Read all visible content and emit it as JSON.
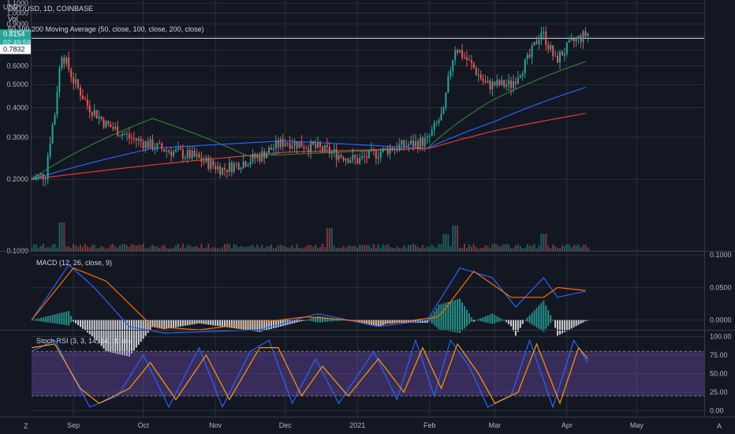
{
  "header": {
    "currency": "USD",
    "symbol_line": "OXT/USD, 1D, COINBASE",
    "vol_label": "Vol",
    "ma_label": "50,100,200 Moving Average (50, close, 100, close, 200, close)"
  },
  "price_tags": {
    "last_price": "0.8154",
    "countdown": "02:49:59",
    "level": "0.7832"
  },
  "corners": {
    "bottom_left": "Z",
    "bottom_right": "A"
  },
  "colors": {
    "background": "#131722",
    "grid": "#2a2e39",
    "up": "#26a69a",
    "down": "#ef5350",
    "ma50": "#2e7d32",
    "ma100": "#2962ff",
    "ma200": "#e53935",
    "macd_line": "#2962ff",
    "signal_line": "#ff6d00",
    "stoch_k": "#2962ff",
    "stoch_d": "#ff9800",
    "stoch_band": "#7e57c2",
    "price_tag": "#26a69a",
    "level_tag": "#ffffff"
  },
  "chart_data": {
    "type": "candlestick",
    "x_ticks": [
      "Sep",
      "Oct",
      "Nov",
      "Dec",
      "2021",
      "Feb",
      "Mar",
      "Apr",
      "May"
    ],
    "x_range": [
      "2020-08-14",
      "2021-05-30"
    ],
    "price_axis": {
      "ticks": [
        "1.1000",
        "1.0000",
        "0.9000",
        "0.8000",
        "0.7000",
        "0.6000",
        "0.5000",
        "0.4000",
        "0.3000",
        "0.2000",
        "0.1000"
      ],
      "range": [
        0.1,
        1.1
      ],
      "scale": "log"
    },
    "horizontal_line": 0.7832,
    "price_path": [
      [
        "2020-08-14",
        0.2
      ],
      [
        "2020-08-20",
        0.21
      ],
      [
        "2020-08-24",
        0.38
      ],
      [
        "2020-08-27",
        0.68
      ],
      [
        "2020-09-01",
        0.52
      ],
      [
        "2020-09-07",
        0.41
      ],
      [
        "2020-09-15",
        0.34
      ],
      [
        "2020-09-25",
        0.3
      ],
      [
        "2020-10-08",
        0.27
      ],
      [
        "2020-10-22",
        0.25
      ],
      [
        "2020-11-04",
        0.22
      ],
      [
        "2020-11-20",
        0.25
      ],
      [
        "2020-12-01",
        0.29
      ],
      [
        "2020-12-15",
        0.27
      ],
      [
        "2021-01-01",
        0.24
      ],
      [
        "2021-01-15",
        0.27
      ],
      [
        "2021-01-31",
        0.29
      ],
      [
        "2021-02-07",
        0.38
      ],
      [
        "2021-02-12",
        0.72
      ],
      [
        "2021-02-18",
        0.62
      ],
      [
        "2021-02-25",
        0.5
      ],
      [
        "2021-03-08",
        0.5
      ],
      [
        "2021-03-16",
        0.65
      ],
      [
        "2021-03-21",
        0.84
      ],
      [
        "2021-03-27",
        0.63
      ],
      [
        "2021-04-04",
        0.76
      ],
      [
        "2021-04-10",
        0.82
      ]
    ],
    "ma50_path": [
      [
        "2020-08-14",
        0.2
      ],
      [
        "2020-10-05",
        0.36
      ],
      [
        "2020-11-15",
        0.25
      ],
      [
        "2021-01-31",
        0.27
      ],
      [
        "2021-02-28",
        0.43
      ],
      [
        "2021-04-10",
        0.63
      ]
    ],
    "ma100_path": [
      [
        "2020-08-14",
        0.2
      ],
      [
        "2020-10-05",
        0.27
      ],
      [
        "2020-11-30",
        0.29
      ],
      [
        "2021-01-31",
        0.27
      ],
      [
        "2021-03-01",
        0.35
      ],
      [
        "2021-04-10",
        0.49
      ]
    ],
    "ma200_path": [
      [
        "2020-08-14",
        0.2
      ],
      [
        "2020-10-05",
        0.23
      ],
      [
        "2020-12-01",
        0.26
      ],
      [
        "2021-02-01",
        0.27
      ],
      [
        "2021-03-01",
        0.32
      ],
      [
        "2021-04-10",
        0.38
      ]
    ],
    "volume_spikes": [
      [
        "2020-08-27",
        1.0
      ],
      [
        "2020-12-20",
        0.8
      ],
      [
        "2021-02-08",
        0.6
      ],
      [
        "2021-02-12",
        0.9
      ],
      [
        "2021-03-22",
        0.6
      ]
    ],
    "macd": {
      "label": "MACD (12, 26, close, 9)",
      "ticks": [
        "0.1000",
        "0.0500",
        "0.0000"
      ],
      "range": [
        -0.015,
        0.105
      ],
      "macd_path": [
        [
          "2020-08-14",
          0.0
        ],
        [
          "2020-08-30",
          0.085
        ],
        [
          "2020-09-10",
          0.05
        ],
        [
          "2020-09-25",
          -0.01
        ],
        [
          "2020-10-10",
          -0.02
        ],
        [
          "2020-11-20",
          -0.015
        ],
        [
          "2020-12-15",
          0.01
        ],
        [
          "2021-01-10",
          -0.01
        ],
        [
          "2021-01-31",
          0.0
        ],
        [
          "2021-02-14",
          0.08
        ],
        [
          "2021-02-28",
          0.065
        ],
        [
          "2021-03-10",
          0.02
        ],
        [
          "2021-03-22",
          0.065
        ],
        [
          "2021-03-28",
          0.035
        ],
        [
          "2021-04-10",
          0.045
        ]
      ],
      "signal_path": [
        [
          "2020-08-14",
          0.0
        ],
        [
          "2020-09-01",
          0.08
        ],
        [
          "2020-09-15",
          0.06
        ],
        [
          "2020-10-05",
          -0.01
        ],
        [
          "2020-10-25",
          -0.015
        ],
        [
          "2020-12-10",
          0.005
        ],
        [
          "2021-01-15",
          -0.005
        ],
        [
          "2021-02-05",
          0.005
        ],
        [
          "2021-02-20",
          0.075
        ],
        [
          "2021-03-08",
          0.035
        ],
        [
          "2021-03-22",
          0.035
        ],
        [
          "2021-03-28",
          0.05
        ],
        [
          "2021-04-10",
          0.045
        ]
      ]
    },
    "stoch_rsi": {
      "label": "Stoch RSI (3, 3, 14, 14, close)",
      "ticks": [
        "100.00",
        "75.00",
        "50.00",
        "25.00",
        "0.00"
      ],
      "range": [
        -8,
        108
      ],
      "band": [
        20,
        80
      ],
      "k_path": [
        [
          "2020-08-14",
          80
        ],
        [
          "2020-08-24",
          95
        ],
        [
          "2020-09-01",
          45
        ],
        [
          "2020-09-08",
          5
        ],
        [
          "2020-09-20",
          20
        ],
        [
          "2020-10-01",
          75
        ],
        [
          "2020-10-12",
          5
        ],
        [
          "2020-10-25",
          85
        ],
        [
          "2020-11-04",
          5
        ],
        [
          "2020-11-16",
          80
        ],
        [
          "2020-11-24",
          95
        ],
        [
          "2020-12-04",
          10
        ],
        [
          "2020-12-14",
          70
        ],
        [
          "2020-12-24",
          10
        ],
        [
          "2021-01-08",
          80
        ],
        [
          "2021-01-18",
          15
        ],
        [
          "2021-01-26",
          95
        ],
        [
          "2021-02-03",
          20
        ],
        [
          "2021-02-10",
          95
        ],
        [
          "2021-02-18",
          60
        ],
        [
          "2021-02-26",
          5
        ],
        [
          "2021-03-08",
          20
        ],
        [
          "2021-03-16",
          95
        ],
        [
          "2021-03-26",
          5
        ],
        [
          "2021-04-04",
          95
        ],
        [
          "2021-04-10",
          65
        ]
      ],
      "d_path": [
        [
          "2020-08-14",
          85
        ],
        [
          "2020-08-24",
          90
        ],
        [
          "2020-09-04",
          30
        ],
        [
          "2020-09-12",
          10
        ],
        [
          "2020-09-25",
          30
        ],
        [
          "2020-10-04",
          65
        ],
        [
          "2020-10-15",
          15
        ],
        [
          "2020-10-28",
          75
        ],
        [
          "2020-11-07",
          15
        ],
        [
          "2020-11-20",
          85
        ],
        [
          "2020-11-28",
          85
        ],
        [
          "2020-12-08",
          20
        ],
        [
          "2020-12-17",
          60
        ],
        [
          "2020-12-28",
          20
        ],
        [
          "2021-01-10",
          70
        ],
        [
          "2021-01-21",
          25
        ],
        [
          "2021-01-29",
          85
        ],
        [
          "2021-02-06",
          30
        ],
        [
          "2021-02-13",
          90
        ],
        [
          "2021-02-22",
          50
        ],
        [
          "2021-03-01",
          10
        ],
        [
          "2021-03-11",
          25
        ],
        [
          "2021-03-19",
          90
        ],
        [
          "2021-03-29",
          10
        ],
        [
          "2021-04-06",
          85
        ],
        [
          "2021-04-10",
          70
        ]
      ]
    }
  }
}
